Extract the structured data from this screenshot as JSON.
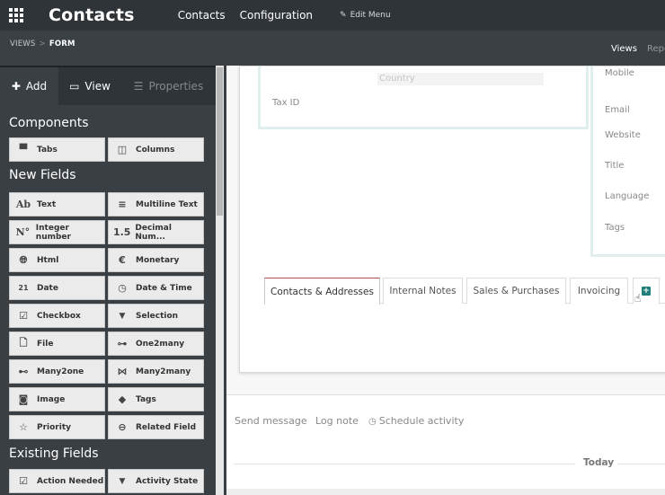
{
  "topnav": {
    "app_title": "Contacts",
    "menu": [
      "Contacts",
      "Configuration"
    ],
    "edit_menu": "Edit Menu"
  },
  "subbar": {
    "breadcrumb_root": "VIEWS",
    "breadcrumb_separator": ">",
    "breadcrumb_current": "FORM",
    "tab_views": "Views",
    "tab_reports": "Repo"
  },
  "sidebar": {
    "tabs": {
      "add": "Add",
      "view": "View",
      "properties": "Properties"
    },
    "sections": {
      "components": "Components",
      "new_fields": "New Fields",
      "existing_fields": "Existing Fields"
    },
    "components": [
      {
        "label": "Tabs",
        "icon": "tabs-icon"
      },
      {
        "label": "Columns",
        "icon": "columns-icon"
      }
    ],
    "new_fields": [
      {
        "label": "Text",
        "icon_text": "Ab"
      },
      {
        "label": "Multiline Text",
        "icon_text": "≡"
      },
      {
        "label": "Integer number",
        "icon_text": "N°"
      },
      {
        "label": "Decimal Num...",
        "icon_text": "1.5"
      },
      {
        "label": "Html",
        "icon_text": "🌐︎"
      },
      {
        "label": "Monetary",
        "icon_text": "€"
      },
      {
        "label": "Date",
        "icon_text": "21"
      },
      {
        "label": "Date & Time",
        "icon_text": "◷"
      },
      {
        "label": "Checkbox",
        "icon_text": "☑"
      },
      {
        "label": "Selection",
        "icon_text": "▼"
      },
      {
        "label": "File",
        "icon_text": "🗋︎"
      },
      {
        "label": "One2many",
        "icon_text": "⊶"
      },
      {
        "label": "Many2one",
        "icon_text": "⊷"
      },
      {
        "label": "Many2many",
        "icon_text": "⋈"
      },
      {
        "label": "Image",
        "icon_text": "◙"
      },
      {
        "label": "Tags",
        "icon_text": "◆"
      },
      {
        "label": "Priority",
        "icon_text": "☆"
      },
      {
        "label": "Related Field",
        "icon_text": "⊖"
      }
    ],
    "existing_fields": [
      {
        "label": "Action Needed",
        "icon_text": "☑"
      },
      {
        "label": "Activity State",
        "icon_text": "▼"
      }
    ]
  },
  "form": {
    "country_placeholder": "Country",
    "tax_id_label": "Tax ID",
    "right_labels": [
      "Mobile",
      "Email",
      "Website",
      "Title",
      "Language",
      "Tags"
    ],
    "notebook_tabs": [
      "Contacts & Addresses",
      "Internal Notes",
      "Sales & Purchases",
      "Invoicing"
    ],
    "add_tab_symbol": "+"
  },
  "chatter": {
    "send_message": "Send message",
    "log_note": "Log note",
    "schedule_activity": "Schedule activity",
    "today": "Today"
  },
  "colors": {
    "topbar_bg": "#2f3439",
    "sidebar_bg": "#3a3f44",
    "accent_teal": "#1f7d7a"
  }
}
